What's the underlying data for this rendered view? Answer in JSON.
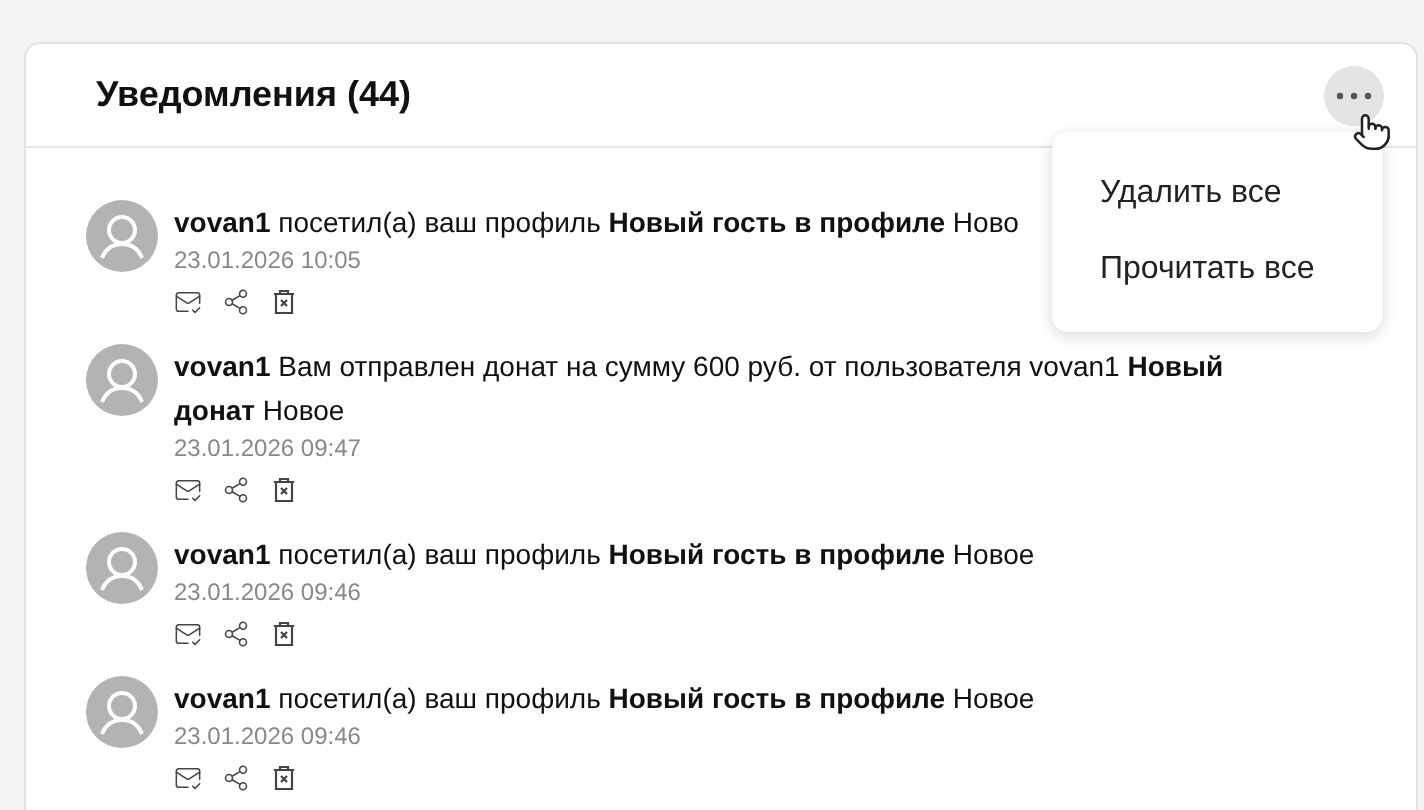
{
  "header": {
    "title": "Уведомления (44)"
  },
  "menu": {
    "items": [
      "Удалить все",
      "Прочитать все"
    ]
  },
  "notifications": [
    {
      "text": "**vovan1** посетил(а) ваш профиль **Новый гость в профиле** Ново",
      "time": "23.01.2026 10:05"
    },
    {
      "text": "**vovan1** Вам отправлен донат на сумму 600 руб. от пользователя vovan1 **Новый донат** Новое",
      "time": "23.01.2026 09:47"
    },
    {
      "text": "**vovan1** посетил(а) ваш профиль **Новый гость в профиле** Новое",
      "time": "23.01.2026 09:46"
    },
    {
      "text": "**vovan1** посетил(а) ваш профиль **Новый гость в профиле** Новое",
      "time": "23.01.2026 09:46"
    }
  ]
}
